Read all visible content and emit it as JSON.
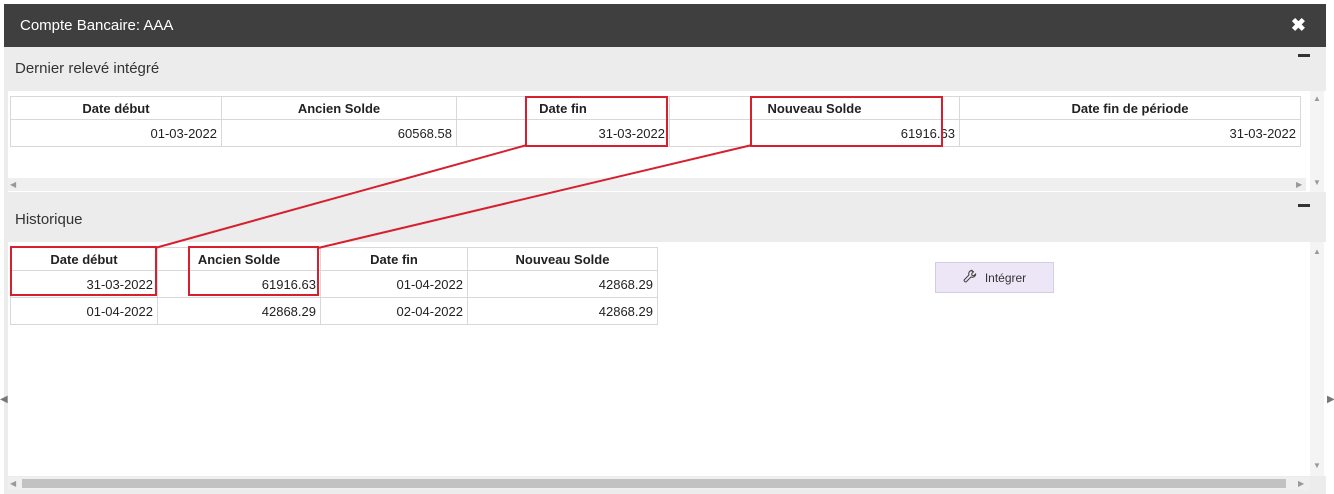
{
  "dialog": {
    "title": "Compte Bancaire: AAA",
    "close_glyph": "✖"
  },
  "last_statement": {
    "title": "Dernier relevé intégré",
    "columns": [
      "Date début",
      "Ancien Solde",
      "Date fin",
      "Nouveau Solde",
      "Date fin de période"
    ],
    "row": [
      "01-03-2022",
      "60568.58",
      "31-03-2022",
      "61916.63",
      "31-03-2022"
    ]
  },
  "history": {
    "title": "Historique",
    "columns": [
      "Date début",
      "Ancien Solde",
      "Date fin",
      "Nouveau Solde"
    ],
    "rows": [
      [
        "31-03-2022",
        "61916.63",
        "01-04-2022",
        "42868.29"
      ],
      [
        "01-04-2022",
        "42868.29",
        "02-04-2022",
        "42868.29"
      ]
    ]
  },
  "integrate_button": {
    "label": "Intégrer",
    "icon": "wrench-icon"
  },
  "colors": {
    "titlebar": "#3f3f3f",
    "highlight": "#d6202e",
    "button_bg": "#ece6f6"
  }
}
